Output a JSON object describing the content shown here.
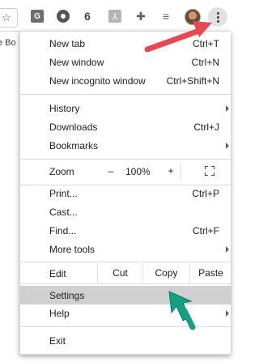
{
  "toolbar": {
    "bookmark_partial": "e Bo"
  },
  "menu": {
    "new_tab": {
      "label": "New tab",
      "shortcut": "Ctrl+T"
    },
    "new_window": {
      "label": "New window",
      "shortcut": "Ctrl+N"
    },
    "new_incognito": {
      "label": "New incognito window",
      "shortcut": "Ctrl+Shift+N"
    },
    "history": {
      "label": "History"
    },
    "downloads": {
      "label": "Downloads",
      "shortcut": "Ctrl+J"
    },
    "bookmarks": {
      "label": "Bookmarks"
    },
    "zoom": {
      "label": "Zoom",
      "minus": "–",
      "value": "100%",
      "plus": "+"
    },
    "print": {
      "label": "Print...",
      "shortcut": "Ctrl+P"
    },
    "cast": {
      "label": "Cast..."
    },
    "find": {
      "label": "Find...",
      "shortcut": "Ctrl+F"
    },
    "more_tools": {
      "label": "More tools"
    },
    "edit": {
      "label": "Edit",
      "cut": "Cut",
      "copy": "Copy",
      "paste": "Paste"
    },
    "settings": {
      "label": "Settings"
    },
    "help": {
      "label": "Help"
    },
    "exit": {
      "label": "Exit"
    }
  },
  "colors": {
    "highlight": "#d0d0d0",
    "red_arrow": "#e84850",
    "green_arrow": "#16a082"
  }
}
